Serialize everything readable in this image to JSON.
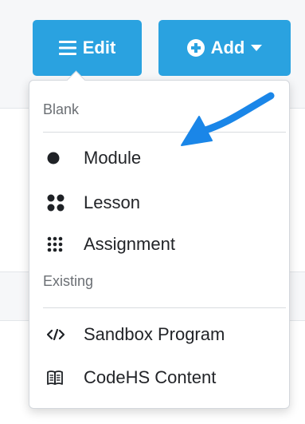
{
  "toolbar": {
    "edit_label": "Edit",
    "add_label": "Add"
  },
  "menu": {
    "blank_header": "Blank",
    "existing_header": "Existing",
    "blank_items": [
      {
        "label": "Module",
        "icon": "dot-icon"
      },
      {
        "label": "Lesson",
        "icon": "four-dots-icon"
      },
      {
        "label": "Assignment",
        "icon": "nine-dots-icon"
      }
    ],
    "existing_items": [
      {
        "label": "Sandbox Program",
        "icon": "code-icon"
      },
      {
        "label": "CodeHS Content",
        "icon": "book-icon"
      }
    ]
  },
  "colors": {
    "accent": "#2aa2e0",
    "arrow": "#1a86e8"
  }
}
